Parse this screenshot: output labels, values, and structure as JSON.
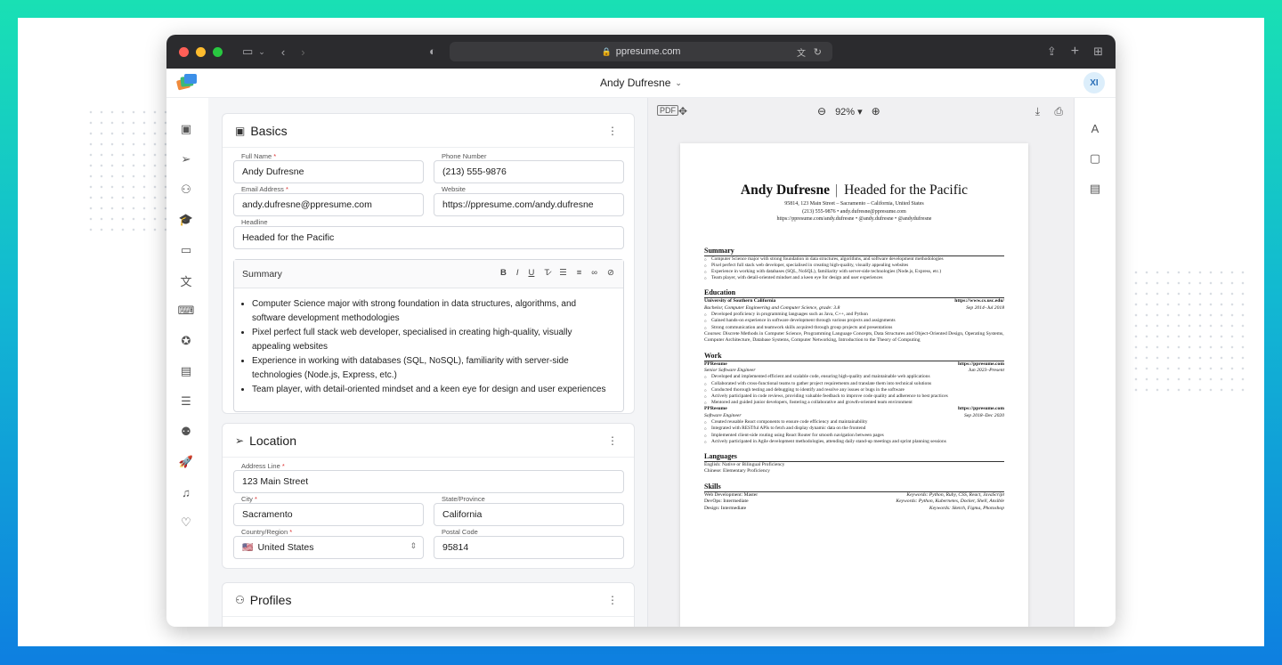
{
  "browser": {
    "url": "ppresume.com"
  },
  "header": {
    "doc_title": "Andy Dufresne",
    "avatar_initials": "XI"
  },
  "basics": {
    "title": "Basics",
    "full_name": {
      "label": "Full Name",
      "value": "Andy Dufresne"
    },
    "phone": {
      "label": "Phone Number",
      "value": "(213) 555-9876"
    },
    "email": {
      "label": "Email Address",
      "value": "andy.dufresne@ppresume.com"
    },
    "website": {
      "label": "Website",
      "value": "https://ppresume.com/andy.dufresne"
    },
    "headline": {
      "label": "Headline",
      "value": "Headed for the Pacific"
    },
    "summary_label": "Summary",
    "summary_items": [
      "Computer Science major with strong foundation in data structures, algorithms, and software development methodologies",
      "Pixel perfect full stack web developer, specialised in creating high-quality, visually appealing websites",
      "Experience in working with databases (SQL, NoSQL), familiarity with server-side technologies (Node.js, Express, etc.)",
      "Team player, with detail-oriented mindset and a keen eye for design and user experiences"
    ]
  },
  "location": {
    "title": "Location",
    "address": {
      "label": "Address Line",
      "value": "123 Main Street"
    },
    "city": {
      "label": "City",
      "value": "Sacramento"
    },
    "state": {
      "label": "State/Province",
      "value": "California"
    },
    "country": {
      "label": "Country/Region",
      "value": "United States",
      "flag": "🇺🇸"
    },
    "postal": {
      "label": "Postal Code",
      "value": "95814"
    }
  },
  "profiles": {
    "title": "Profiles"
  },
  "preview": {
    "zoom": "92%",
    "resume": {
      "name": "Andy Dufresne",
      "headline": "Headed for the Pacific",
      "address_line": "95814, 123 Main Street – Sacramento – California, United States",
      "contact_line": "(213) 555-9876  •  andy.dufresne@ppresume.com",
      "social_line": "https://ppresume.com/andy.dufresne  •  @andy.dufresne  •  @andydufresne",
      "summary_title": "Summary",
      "summary": [
        "Computer Science major with strong foundation in data structures, algorithms, and software development methodologies",
        "Pixel perfect full stack web developer, specialised in creating high-quality, visually appealing websites",
        "Experience in working with databases (SQL, NoSQL), familiarity with server-side technologies (Node.js, Express, etc.)",
        "Team player, with detail-oriented mindset and a keen eye for design and user experiences"
      ],
      "education_title": "Education",
      "edu_school": "University of Southern California",
      "edu_url": "https://www.cs.usc.edu/",
      "edu_degree": "Bachelor, Computer Engineering and Computer Science, grade: 3.8",
      "edu_dates": "Sep 2014–Jul 2018",
      "edu_bullets": [
        "Developed proficiency in programming languages such as Java, C++, and Python",
        "Gained hands-on experience in software development through various projects and assignments",
        "Strong communication and teamwork skills acquired through group projects and presentations"
      ],
      "edu_courses": "Courses: Discrete Methods in Computer Science, Programming Language Concepts, Data Structures and Object-Oriented Design, Operating Systems, Computer Architecture, Database Systems, Computer Networking, Introduction to the Theory of Computing",
      "work_title": "Work",
      "work1_company": "PPResume",
      "work1_url": "https://ppresume.com",
      "work1_role": "Senior Software Engineer",
      "work1_dates": "Jun 2023–Present",
      "work1_bullets": [
        "Developed and implemented efficient and scalable code, ensuring high-quality and maintainable web applications",
        "Collaborated with cross-functional teams to gather project requirements and translate them into technical solutions",
        "Conducted thorough testing and debugging to identify and resolve any issues or bugs in the software",
        "Actively participated in code reviews, providing valuable feedback to improve code quality and adherence to best practices",
        "Mentored and guided junior developers, fostering a collaborative and growth-oriented team environment"
      ],
      "work2_company": "PPResume",
      "work2_url": "https://ppresume.com",
      "work2_role": "Software Engineer",
      "work2_dates": "Sep 2018–Dec 2020",
      "work2_bullets": [
        "Created reusable React components to ensure code efficiency and maintainability",
        "Integrated with RESTful APIs to fetch and display dynamic data on the frontend",
        "Implemented client-side routing using React Router for smooth navigation between pages",
        "Actively participated in Agile development methodologies, attending daily stand-up meetings and sprint planning sessions"
      ],
      "languages_title": "Languages",
      "lang1": "English: Native or Bilingual Proficiency",
      "lang2": "Chinese: Elementary Proficiency",
      "skills_title": "Skills",
      "skills": [
        {
          "name": "Web Development: Master",
          "keywords": "Keywords: Python, Ruby, CSS, React, JavaScript"
        },
        {
          "name": "DevOps: Intermediate",
          "keywords": "Keywords: Python, Kubernetes, Docker, Shell, Ansible"
        },
        {
          "name": "Design: Intermediate",
          "keywords": "Keywords: Sketch, Figma, Photoshop"
        }
      ]
    }
  },
  "colors": {
    "traffic_red": "#ff5f57",
    "traffic_yellow": "#febc2e",
    "traffic_green": "#28c840"
  }
}
